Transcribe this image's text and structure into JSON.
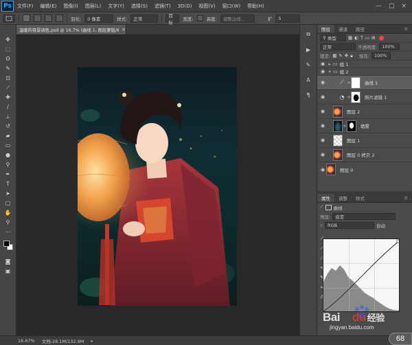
{
  "app": {
    "logo": "Ps"
  },
  "menu": [
    "文件(F)",
    "编辑(E)",
    "图像(I)",
    "图层(L)",
    "文字(Y)",
    "选择(S)",
    "滤镜(T)",
    "3D(D)",
    "视图(V)",
    "窗口(W)",
    "帮助(H)"
  ],
  "window_controls": {
    "minimize": "—",
    "maximize": "□",
    "close": "×"
  },
  "options_bar": {
    "feather_label": "羽化:",
    "feather_value": "0 像素",
    "style_label": "样式:",
    "style_value": "正常",
    "width_label": "宽度:",
    "height_label": "高度:",
    "edge_label": "调整边缘...",
    "zoom_value": "5",
    "extra_label": "扩",
    "subtract_label": "目标"
  },
  "document": {
    "tab_title": "温暖的夜景调色.psd @ 16.7% (曲线 1, 图层蒙版/8) *",
    "close_glyph": "×"
  },
  "status": {
    "zoom": "16.67%",
    "doc_size": "文档:28.1M/132.9M"
  },
  "layers_panel": {
    "tabs": [
      "图层",
      "通道",
      "路径"
    ],
    "filter_kind": "类型",
    "blend_mode": "正常",
    "opacity_label": "不透明度:",
    "opacity_value": "100%",
    "lock_label": "锁定:",
    "fill_label": "填充:",
    "fill_value": "100%",
    "layers": [
      {
        "name": "组 1",
        "kind": "group",
        "selected": false,
        "thumb": "none"
      },
      {
        "name": "组 2",
        "kind": "group",
        "selected": false,
        "thumb": "none"
      },
      {
        "name": "曲线 1",
        "kind": "curves",
        "selected": true,
        "thumb": "mask-white"
      },
      {
        "name": "照片滤镜 1",
        "kind": "photo-filter",
        "selected": false,
        "thumb": "mask-shape"
      },
      {
        "name": "图层 2",
        "kind": "pixel",
        "selected": false,
        "thumb": "portrait"
      },
      {
        "name": "烟雾",
        "kind": "pixel",
        "selected": false,
        "thumb": "smoke"
      },
      {
        "name": "图层 1",
        "kind": "pixel",
        "selected": false,
        "thumb": "checker"
      },
      {
        "name": "图层 0 拷贝 2",
        "kind": "pixel",
        "selected": false,
        "thumb": "portrait"
      },
      {
        "name": "图层 0",
        "kind": "pixel",
        "selected": false,
        "thumb": "portrait"
      }
    ]
  },
  "properties_panel": {
    "tabs": [
      "属性",
      "调整",
      "样式"
    ],
    "title": "曲线",
    "preset_label": "预设:",
    "preset_value": "自定",
    "channel_value": "RGB",
    "auto_label": "自动"
  },
  "colors": {
    "foreground": "#000000",
    "background": "#ffffff",
    "lantern": "#f0a049",
    "robe": "#8e2a32",
    "night_bg": "#0f2d33"
  },
  "watermark": {
    "brand": "Bai",
    "brand_b": "du",
    "brand_cn": "经验",
    "url": "jingyan.baidu.com"
  },
  "badge": {
    "value": "68"
  }
}
